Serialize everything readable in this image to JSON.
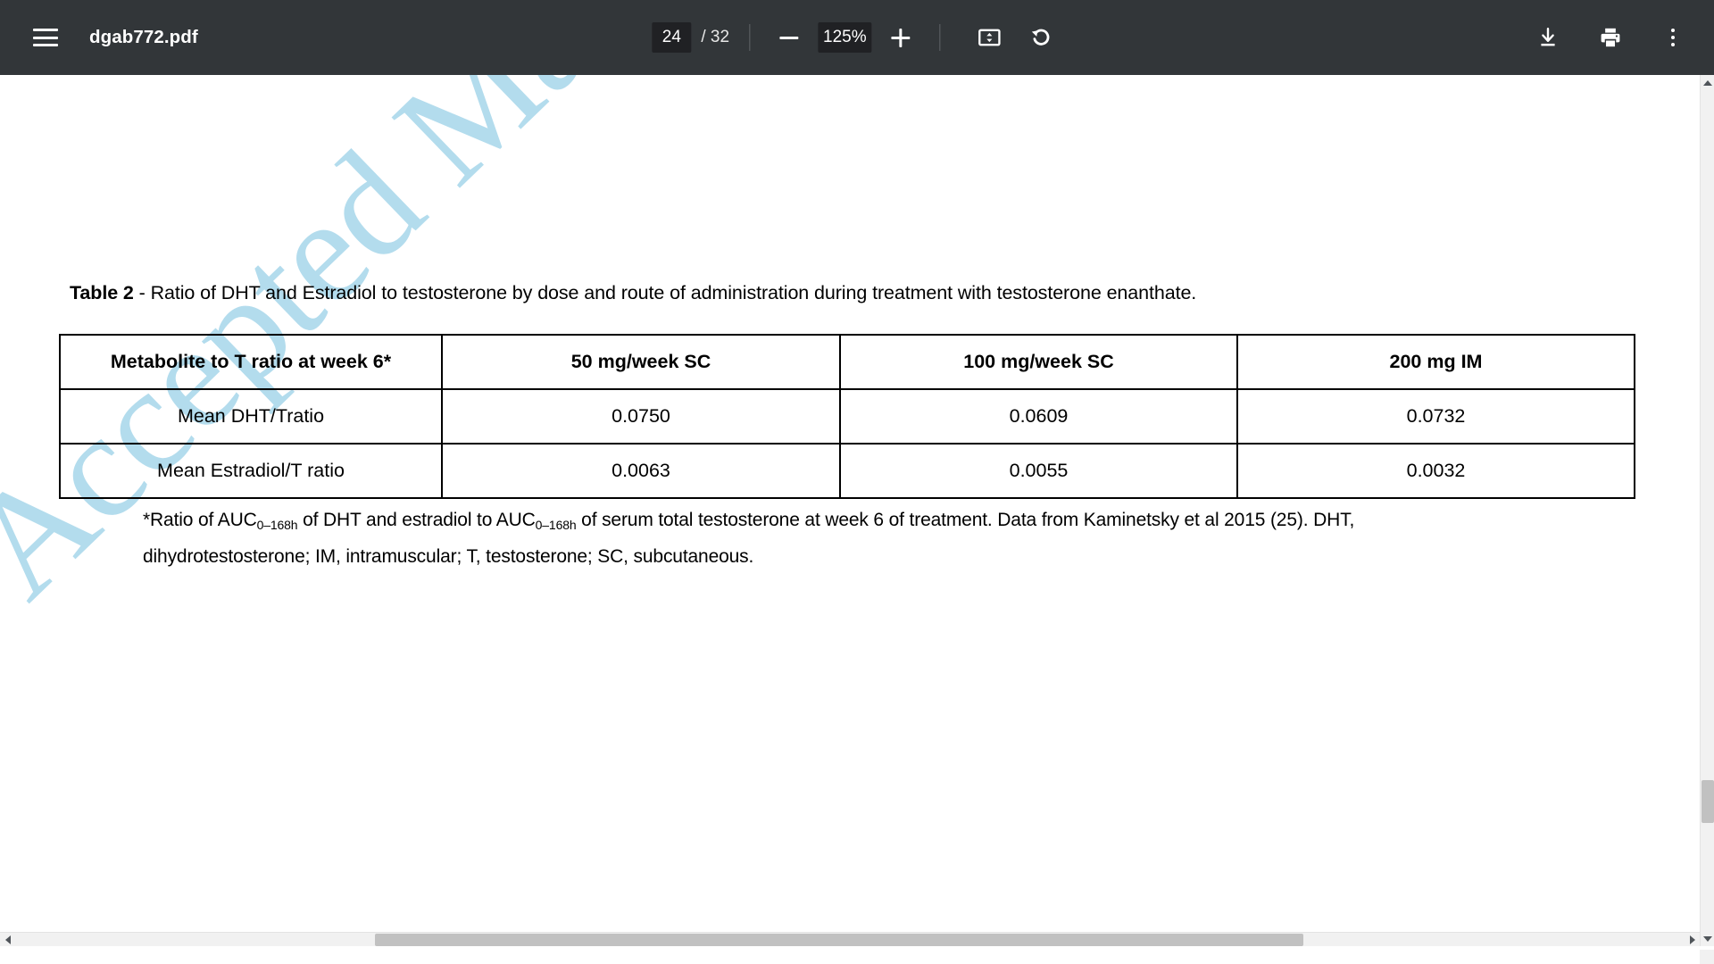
{
  "toolbar": {
    "menu_icon": "hamburger-menu-icon",
    "file_name": "dgab772.pdf",
    "page_number": "24",
    "page_count": "/ 32",
    "total_pages": "32",
    "zoom_out_icon": "minus-icon",
    "zoom_level": "125%",
    "zoom_in_icon": "plus-icon",
    "fit_page_icon": "fit-to-page-icon",
    "rotate_icon": "rotate-counterclockwise-icon",
    "download_icon": "download-icon",
    "print_icon": "print-icon",
    "more_icon": "more-vertical-icon",
    "background_color": "#323639",
    "field_background_color": "#202124"
  },
  "document": {
    "watermark": "Accepted Manuscript",
    "watermark_color": "#b3dced",
    "caption": {
      "label": "Table 2",
      "text": " - Ratio of DHT and Estradiol to testosterone by dose and route of administration during treatment with testosterone enanthate."
    },
    "footnote": {
      "line1_part1": "*Ratio of AUC",
      "sub1": "0–168h",
      "line1_part2": " of DHT and estradiol to AUC",
      "sub2": "0–168h",
      "line1_part3": " of serum total testosterone at week 6 of treatment. Data from Kaminetsky et al 2015 (25). DHT,",
      "line2": "dihydrotestosterone; IM, intramuscular; T, testosterone; SC, subcutaneous."
    }
  },
  "chart_data": {
    "type": "table",
    "title": "Table 2 - Ratio of DHT and Estradiol to testosterone by dose and route of administration during treatment with testosterone enanthate.",
    "columns": [
      "Metabolite to T ratio at week 6*",
      "50 mg/week SC",
      "100 mg/week SC",
      "200 mg IM"
    ],
    "rows": [
      {
        "label": "Mean DHT/Tratio",
        "values": [
          "0.0750",
          "0.0609",
          "0.0732"
        ]
      },
      {
        "label": "Mean Estradiol/T ratio",
        "values": [
          "0.0063",
          "0.0055",
          "0.0032"
        ]
      }
    ],
    "cells": [
      [
        "Mean DHT/Tratio",
        "0.0750",
        "0.0609",
        "0.0732"
      ],
      [
        "Mean Estradiol/T ratio",
        "0.0063",
        "0.0055",
        "0.0032"
      ]
    ]
  },
  "scrollbars": {
    "vertical_up_icon": "scroll-arrow-up-icon",
    "vertical_down_icon": "scroll-arrow-down-icon",
    "horizontal_left_icon": "scroll-arrow-left-icon",
    "horizontal_right_icon": "scroll-arrow-right-icon"
  }
}
